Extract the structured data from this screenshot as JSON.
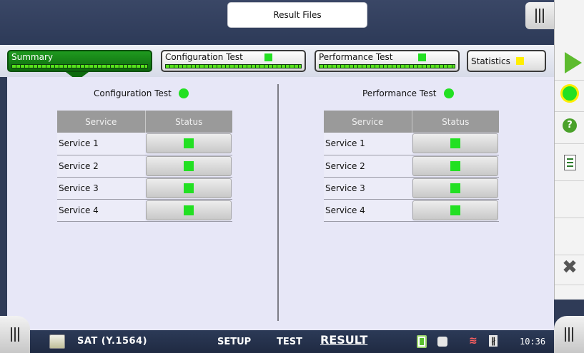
{
  "header": {
    "title": "Result Files"
  },
  "tabs": [
    {
      "label": "Summary",
      "active": true,
      "status_color": "#0e6a0e"
    },
    {
      "label": "Configuration Test",
      "status_color": "#22e022"
    },
    {
      "label": "Performance Test",
      "status_color": "#22e022"
    },
    {
      "label": "Statistics",
      "status_color": "#ffee00"
    }
  ],
  "panels": [
    {
      "heading": "Configuration Test",
      "status_color": "#22e022",
      "columns": [
        "Service",
        "Status"
      ],
      "rows": [
        {
          "service": "Service 1",
          "status_color": "#22e022"
        },
        {
          "service": "Service 2",
          "status_color": "#22e022"
        },
        {
          "service": "Service 3",
          "status_color": "#22e022"
        },
        {
          "service": "Service 4",
          "status_color": "#22e022"
        }
      ]
    },
    {
      "heading": "Performance Test",
      "status_color": "#22e022",
      "columns": [
        "Service",
        "Status"
      ],
      "rows": [
        {
          "service": "Service 1",
          "status_color": "#22e022"
        },
        {
          "service": "Service 2",
          "status_color": "#22e022"
        },
        {
          "service": "Service 3",
          "status_color": "#22e022"
        },
        {
          "service": "Service 4",
          "status_color": "#22e022"
        }
      ]
    }
  ],
  "sidebar": {
    "icons": [
      "start-test-icon",
      "status-indicator-icon",
      "help-icon",
      "report-icon",
      "close-icon"
    ],
    "help_glyph": "?",
    "close_glyph": "✖"
  },
  "bottom_bar": {
    "app_name": "SAT (Y.1564)",
    "nav": {
      "setup": "SETUP",
      "test": "TEST",
      "result": "RESULT"
    },
    "time": "10:36",
    "bluetooth_glyph": "∦",
    "wifi_glyph": "≋"
  }
}
